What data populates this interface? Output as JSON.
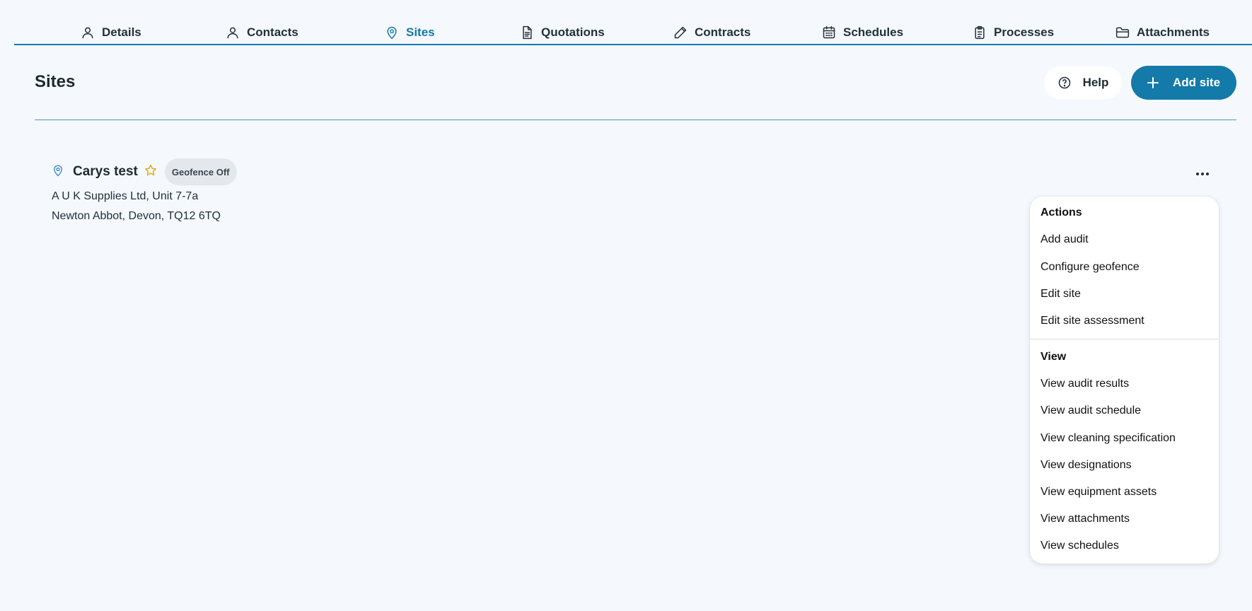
{
  "tabs": [
    {
      "label": "Details",
      "icon": "user-icon"
    },
    {
      "label": "Contacts",
      "icon": "user-icon"
    },
    {
      "label": "Sites",
      "icon": "map-pin-icon",
      "active": true
    },
    {
      "label": "Quotations",
      "icon": "document-icon"
    },
    {
      "label": "Contracts",
      "icon": "pencil-icon"
    },
    {
      "label": "Schedules",
      "icon": "calendar-icon"
    },
    {
      "label": "Processes",
      "icon": "clipboard-icon"
    },
    {
      "label": "Attachments",
      "icon": "folder-icon"
    }
  ],
  "header": {
    "title": "Sites",
    "help_label": "Help",
    "add_label": "Add site"
  },
  "site": {
    "name": "Carys test",
    "badge": "Geofence Off",
    "address_line1": "A U K Supplies Ltd, Unit 7-7a",
    "address_line2": "Newton Abbot, Devon, TQ12 6TQ"
  },
  "menu": {
    "actions_heading": "Actions",
    "actions": [
      "Add audit",
      "Configure geofence",
      "Edit site",
      "Edit site assessment"
    ],
    "view_heading": "View",
    "view": [
      "View audit results",
      "View audit schedule",
      "View cleaning specification",
      "View designations",
      "View equipment assets",
      "View attachments",
      "View schedules"
    ]
  },
  "colors": {
    "accent": "#137aa9",
    "background": "#f5f9fe",
    "favorite_star": "#e0ad18",
    "pin": "#3a86d6"
  }
}
